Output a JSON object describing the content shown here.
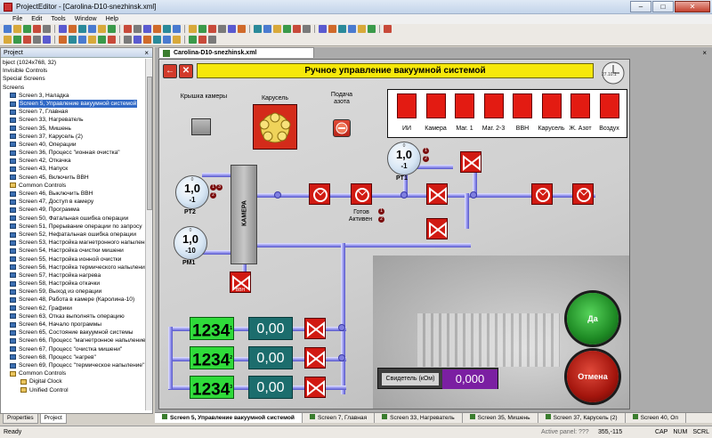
{
  "window": {
    "title": "ProjectEditor - [Carolina-D10-snezhinsk.xml]",
    "minimize": "–",
    "maximize": "□",
    "close": "✕"
  },
  "menu": {
    "file": "File",
    "edit": "Edit",
    "tools": "Tools",
    "window": "Window",
    "help": "Help"
  },
  "project_panel": {
    "title": "Project",
    "close": "×",
    "items": [
      {
        "label": "bject (1024x768, 32)",
        "icon": "none"
      },
      {
        "label": "Invisible Controls",
        "icon": "none"
      },
      {
        "label": "Special Screens",
        "icon": "none"
      },
      {
        "label": "Screens",
        "icon": "none"
      },
      {
        "label": "Screen 3, Наладка",
        "icon": "screen-icon"
      },
      {
        "label": "Screen 5, Управление вакуумной системой",
        "icon": "screen-icon",
        "selected": true
      },
      {
        "label": "Screen 7, Главная",
        "icon": "screen-icon"
      },
      {
        "label": "Screen 33, Нагреватель",
        "icon": "screen-icon"
      },
      {
        "label": "Screen 35, Мишень",
        "icon": "screen-icon"
      },
      {
        "label": "Screen 37, Карусель (2)",
        "icon": "screen-icon"
      },
      {
        "label": "Screen 40, Операции",
        "icon": "screen-icon"
      },
      {
        "label": "Screen 36, Процесс \"ионная очистка\"",
        "icon": "screen-icon"
      },
      {
        "label": "Screen 42, Откачка",
        "icon": "screen-icon"
      },
      {
        "label": "Screen 43, Напуск",
        "icon": "screen-icon"
      },
      {
        "label": "Screen 45, Включить ВВН",
        "icon": "screen-icon"
      },
      {
        "label": "Common Controls",
        "icon": "folder-icon"
      },
      {
        "label": "Screen 46, Выключить ВВН",
        "icon": "screen-icon"
      },
      {
        "label": "Screen 47, Доступ в камеру",
        "icon": "screen-icon"
      },
      {
        "label": "Screen 49, Программа",
        "icon": "screen-icon"
      },
      {
        "label": "Screen 50, Фатальная ошибка операции",
        "icon": "screen-icon"
      },
      {
        "label": "Screen 51, Прерывание операции по запросу",
        "icon": "screen-icon"
      },
      {
        "label": "Screen 52, Нефатальная ошибка операции",
        "icon": "screen-icon"
      },
      {
        "label": "Screen 53, Настройка магнетронного напыления",
        "icon": "screen-icon"
      },
      {
        "label": "Screen 54, Настройка очистки мишени",
        "icon": "screen-icon"
      },
      {
        "label": "Screen 55, Настройка ионной очистки",
        "icon": "screen-icon"
      },
      {
        "label": "Screen 56, Настройка термического напыления",
        "icon": "screen-icon"
      },
      {
        "label": "Screen 57, Настройка нагрева",
        "icon": "screen-icon"
      },
      {
        "label": "Screen 58, Настройка откачки",
        "icon": "screen-icon"
      },
      {
        "label": "Screen 59, Выход из операции",
        "icon": "screen-icon"
      },
      {
        "label": "Screen 48, Работа в камере (Каролина-10)",
        "icon": "screen-icon"
      },
      {
        "label": "Screen 62, Графики",
        "icon": "screen-icon"
      },
      {
        "label": "Screen 63, Отказ выполнять операцию",
        "icon": "screen-icon"
      },
      {
        "label": "Screen 64, Начало программы",
        "icon": "screen-icon"
      },
      {
        "label": "Screen 65, Состояние вакуумной системы",
        "icon": "screen-icon"
      },
      {
        "label": "Screen 66, Процесс \"магнетронное напыление\"",
        "icon": "screen-icon"
      },
      {
        "label": "Screen 67, Процесс \"очистка мишени\"",
        "icon": "screen-icon"
      },
      {
        "label": "Screen 68, Процесс \"нагрев\"",
        "icon": "screen-icon"
      },
      {
        "label": "Screen 69, Процесс \"термическое напыление\"",
        "icon": "screen-icon"
      },
      {
        "label": "Common Controls",
        "icon": "folder-icon"
      },
      {
        "label": "Digital Clock",
        "icon": "folder-icon"
      },
      {
        "label": "Unified Control",
        "icon": "folder-icon"
      }
    ],
    "tabs": [
      "Properties",
      "Project"
    ]
  },
  "document_tab": {
    "label": "Carolina-D10-snezhinsk.xml",
    "close": "×"
  },
  "hmi": {
    "header": "Ручное управление вакуумной системой",
    "clock_label": "27.10.1",
    "back_btn": "←",
    "cancel_btn": "✕",
    "labels": {
      "lid": "Крышка камеры",
      "carousel": "Карусель",
      "nitrogen": "Подача\nазота",
      "ready": "Готов",
      "active": "Активен",
      "chamber": "КАМЕРА",
      "vvn_small": "ВВН"
    },
    "indicators": [
      "ИИ",
      "Камера",
      "Маг. 1",
      "Маг. 2-3",
      "ВВН",
      "Карусель",
      "Ж. Азот",
      "Воздух"
    ],
    "gauges": [
      {
        "zero": "0",
        "value": "1,0",
        "exp": "-1",
        "tag": "PT1"
      },
      {
        "zero": "0",
        "value": "1,0",
        "exp": "-1",
        "tag": "PT2"
      },
      {
        "zero": "0",
        "value": "1,0",
        "exp": "-10",
        "tag": "PM1"
      }
    ],
    "badges": [
      "1",
      "2",
      "3"
    ],
    "counters": [
      {
        "value": "1234",
        "sub": "1",
        "display": "0,00"
      },
      {
        "value": "1234",
        "sub": "2",
        "display": "0,00"
      },
      {
        "value": "1234",
        "sub": "3",
        "display": "0,00"
      }
    ],
    "witness": {
      "label": "Свидетель (кОм)",
      "value": "0,000"
    },
    "yes_btn": "Да",
    "cancel_big_btn": "Отмена"
  },
  "bottom_tabs": [
    "Screen 5, Управление вакуумной системой",
    "Screen 7, Главная",
    "Screen 33, Нагреватель",
    "Screen 35, Мишень",
    "Screen 37, Карусель (2)",
    "Screen 40, Оп"
  ],
  "status": {
    "ready": "Ready",
    "active_panel": "Active panel: ???",
    "coords": "355,-115",
    "caps": "CAP",
    "num": "NUM",
    "scrl": "SCRL"
  },
  "colors": {
    "header_yellow": "#f6e80a",
    "indicator_red": "#e31b12",
    "counter_green": "#2fdb3a",
    "display_teal": "#1c6d6d",
    "witness_purple": "#7b1fa2",
    "selection_blue": "#3169c6"
  }
}
